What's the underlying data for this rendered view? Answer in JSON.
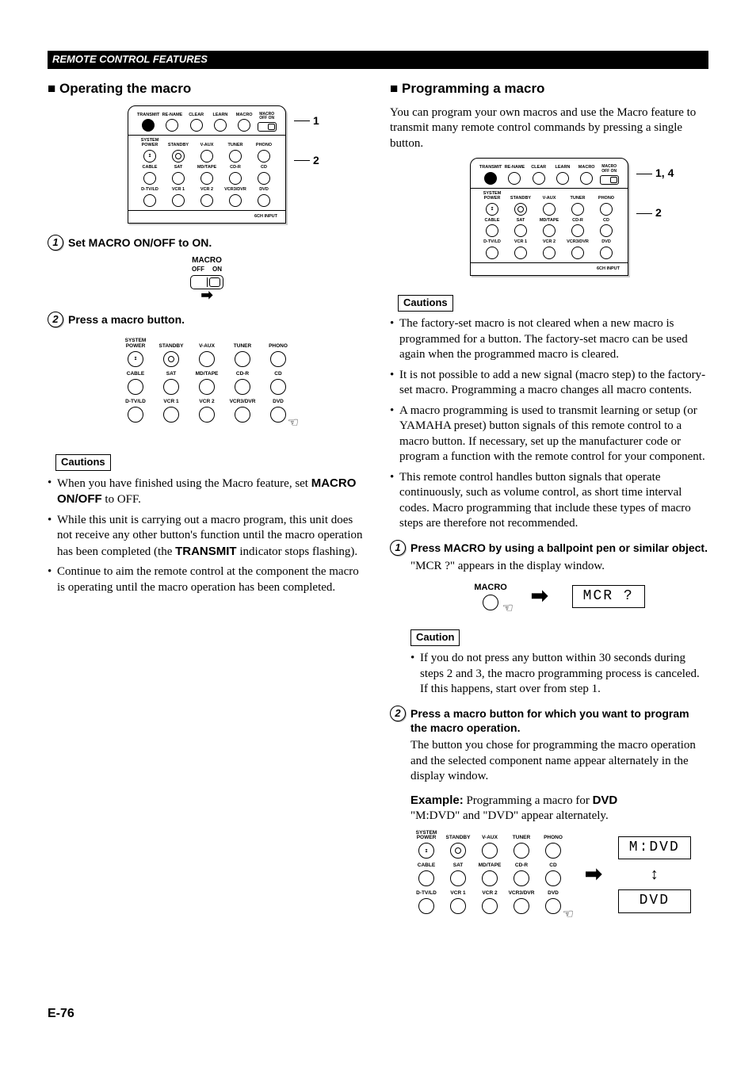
{
  "header": {
    "title": "REMOTE CONTROL FEATURES"
  },
  "left": {
    "section_title": "Operating the macro",
    "remote_row1": [
      "TRANSMIT",
      "RE-NAME",
      "CLEAR",
      "LEARN",
      "MACRO"
    ],
    "macro_switch_label": "MACRO",
    "macro_off": "OFF",
    "macro_on": "ON",
    "remote_grid": [
      [
        "SYSTEM POWER",
        "STANDBY",
        "V-AUX",
        "TUNER",
        "PHONO"
      ],
      [
        "CABLE",
        "SAT",
        "MD/TAPE",
        "CD-R",
        "CD"
      ],
      [
        "D-TV/LD",
        "VCR 1",
        "VCR 2",
        "VCR3/DVR",
        "DVD"
      ]
    ],
    "remote_footer": "6CH INPUT",
    "callout1": "1",
    "callout2": "2",
    "step1": "Set MACRO ON/OFF to ON.",
    "macro_label": "MACRO",
    "step2": "Press a macro button.",
    "cautions_label": "Cautions",
    "cautions": [
      {
        "pre": "When you have finished using the Macro feature, set ",
        "bold": "MACRO ON/OFF",
        "post": " to OFF."
      },
      {
        "pre": "While this unit is carrying out a macro program, this unit does not receive any other button's function until the macro operation has been completed (the ",
        "bold": "TRANSMIT",
        "post": " indicator stops flashing)."
      },
      {
        "pre": "Continue to aim the remote control at the component the macro is operating until the macro operation has been completed.",
        "bold": "",
        "post": ""
      }
    ]
  },
  "right": {
    "section_title": "Programming a macro",
    "intro": "You can program your own macros and use the Macro feature to transmit many remote control commands by pressing a single button.",
    "callout1": "1, 4",
    "callout2": "2",
    "cautions_label": "Cautions",
    "cautions": [
      "The factory-set macro is not cleared when a new macro is programmed for a button. The factory-set macro can be used again when the programmed macro is cleared.",
      "It is not possible to add a new signal (macro step) to the factory-set macro. Programming a macro changes all macro contents.",
      "A macro programming is used to transmit learning or setup (or YAMAHA preset) button signals of this remote control to a macro button. If necessary, set up the manufacturer code or program a function with the remote control for your component.",
      "This remote control handles button signals that operate continuously, such as volume control, as short time interval codes. Macro programming that include these types of macro steps are therefore not recommended."
    ],
    "step1": "Press MACRO by using a ballpoint pen or similar object.",
    "step1_body": "\"MCR ?\" appears in the display window.",
    "macro_label": "MACRO",
    "lcd1": "MCR ?",
    "caution_label": "Caution",
    "caution_single": "If you do not press any button within 30 seconds during steps 2 and 3, the macro programming process is canceled. If this happens, start over from step 1.",
    "step2": "Press a macro button for which you want to program the macro operation.",
    "step2_body": "The button you chose for programming the macro operation and the selected component name appear alternately in the display window.",
    "example_label": "Example:",
    "example_text": " Programming a macro for ",
    "example_bold": "DVD",
    "example_line2": "\"M:DVD\" and \"DVD\" appear alternately.",
    "lcd2a": "M:DVD",
    "lcd2b": "DVD"
  },
  "page": "E-76"
}
